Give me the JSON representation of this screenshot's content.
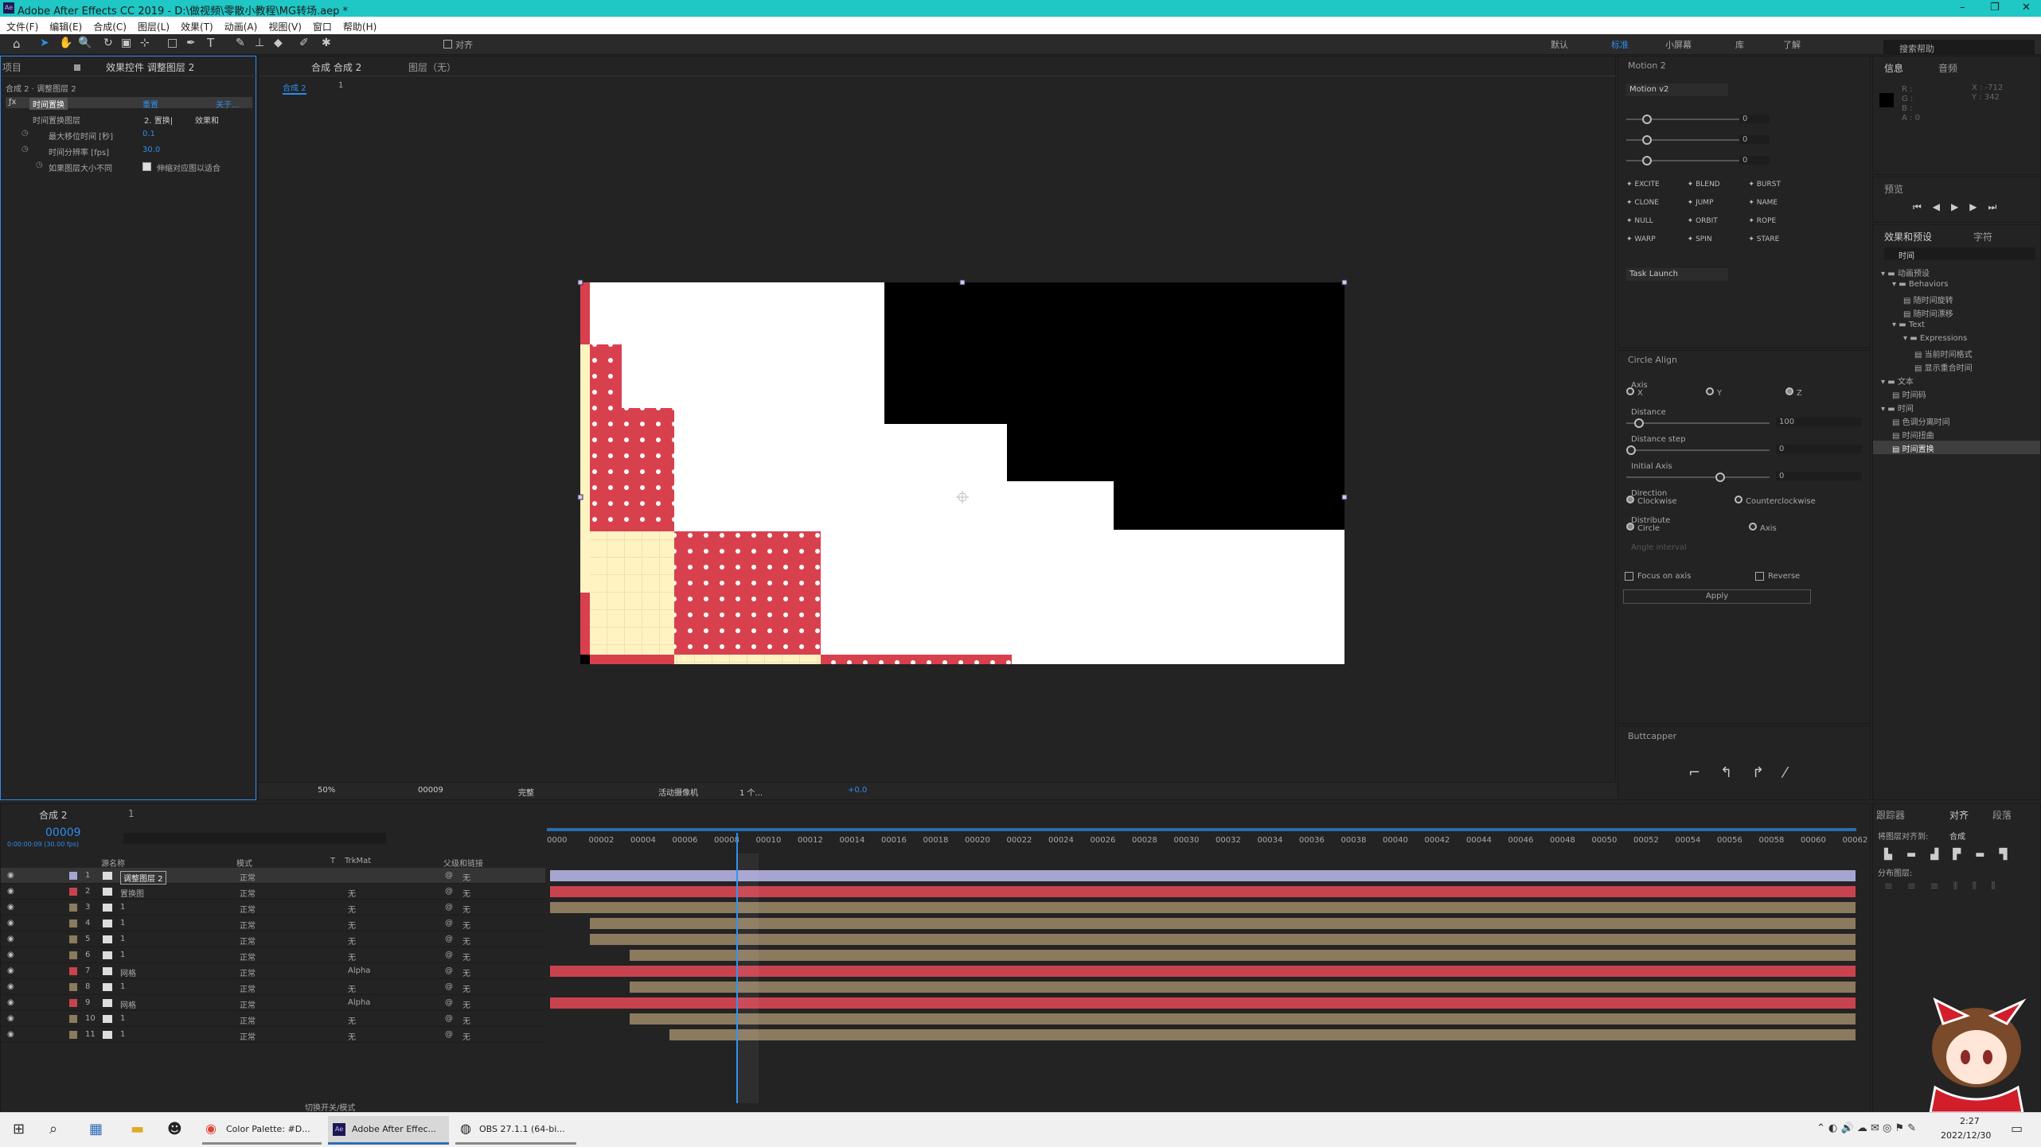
{
  "window": {
    "title": "Adobe After Effects CC 2019 - D:\\做视频\\零散小教程\\MG转场.aep *",
    "min": "–",
    "max": "❐",
    "close": "✕"
  },
  "menu": [
    "文件(F)",
    "编辑(E)",
    "合成(C)",
    "图层(L)",
    "效果(T)",
    "动画(A)",
    "视图(V)",
    "窗口",
    "帮助(H)"
  ],
  "toolbar": {
    "align_label": "对齐",
    "workspaces": [
      "默认",
      "标准",
      "小屏幕",
      "库",
      "了解"
    ],
    "active_workspace": "标准",
    "search_placeholder": "搜索帮助"
  },
  "effect_controls": {
    "project_tab": "项目",
    "tab": "效果控件 调整图层 2",
    "breadcrumb": "合成 2 · 调整图层 2",
    "effect_name": "时间置换",
    "reset": "重置",
    "about": "关于...",
    "rows": [
      {
        "label": "时间置换图层",
        "value": "2. 置换|",
        "value2": "效果和"
      },
      {
        "label": "最大移位时间 [秒]",
        "value": "0.1"
      },
      {
        "label": "时间分辨率 [fps]",
        "value": "30.0"
      },
      {
        "label": "如果图层大小不同",
        "value": "伸缩对应图以适合"
      }
    ]
  },
  "composition": {
    "tab": "合成 合成 2",
    "layer_tab": "图层（无）",
    "crumb": "合成 2",
    "crumb2": "1",
    "zoom": "50%",
    "timecode": "00009",
    "quality": "完整",
    "camera": "活动摄像机",
    "views": "1 个...",
    "exposure": "+0.0"
  },
  "motion": {
    "title": "Motion 2",
    "version": "Motion v2",
    "sliders": [
      "0",
      "0",
      "0"
    ],
    "buttons": [
      "EXCITE",
      "BLEND",
      "BURST",
      "CLONE",
      "JUMP",
      "NAME",
      "NULL",
      "ORBIT",
      "ROPE",
      "WARP",
      "SPIN",
      "STARE"
    ],
    "task": "Task Launch"
  },
  "circle_align": {
    "title": "Circle Align",
    "axis": "Axis",
    "axes": [
      "X",
      "Y",
      "Z"
    ],
    "distance": "Distance",
    "distance_value": "100",
    "distance_step": "Distance step",
    "distance_step_value": "0",
    "initial_axis": "Initial Axis",
    "initial_axis_value": "0",
    "direction": "Direction",
    "cw": "Clockwise",
    "ccw": "Counterclockwise",
    "distribute": "Distribute",
    "circle": "Circle",
    "axis_opt": "Axis",
    "angle": "Angle interval",
    "focus": "Focus on axis",
    "reverse": "Reverse",
    "apply": "Apply"
  },
  "buttcapper": {
    "title": "Buttcapper"
  },
  "info": {
    "tab": "信息",
    "tab2": "音频",
    "r": "R :",
    "g": "G :",
    "b": "B :",
    "a": "A : 0",
    "x": "X : -712",
    "y": "Y : 342"
  },
  "preview": {
    "tab": "预览"
  },
  "effects_presets": {
    "tab": "效果和预设",
    "tab2": "字符",
    "search": "时间",
    "tree": [
      {
        "t": "动画预设",
        "d": 0
      },
      {
        "t": "Behaviors",
        "d": 1
      },
      {
        "t": "随时间旋转",
        "d": 2,
        "f": 1
      },
      {
        "t": "随时间漂移",
        "d": 2,
        "f": 1
      },
      {
        "t": "Text",
        "d": 1
      },
      {
        "t": "Expressions",
        "d": 2
      },
      {
        "t": "当前时间格式",
        "d": 3,
        "f": 1
      },
      {
        "t": "显示重合时间",
        "d": 3,
        "f": 1
      },
      {
        "t": "文本",
        "d": 0
      },
      {
        "t": "时间码",
        "d": 1,
        "f": 1
      },
      {
        "t": "时间",
        "d": 0
      },
      {
        "t": "色调分离时间",
        "d": 1,
        "f": 1
      },
      {
        "t": "时间扭曲",
        "d": 1,
        "f": 1
      },
      {
        "t": "时间置换",
        "d": 1,
        "f": 1,
        "sel": 1
      }
    ]
  },
  "align": {
    "tab1": "跟踪器",
    "tab2": "对齐",
    "tab3": "段落",
    "align_to_label": "将图层对齐到:",
    "align_to": "合成",
    "distribute": "分布图层:"
  },
  "timeline": {
    "tab": "合成 2",
    "tab2": "1",
    "timecode": "00009",
    "fps": "0:00:00:09 (30.00 fps)",
    "search_placeholder": "",
    "headers": {
      "name": "源名称",
      "mode": "模式",
      "t": "T",
      "trkmat": "TrkMat",
      "parent": "父级和链接"
    },
    "ruler": [
      "0000",
      "00002",
      "00004",
      "00006",
      "00008",
      "00010",
      "00012",
      "00014",
      "00016",
      "00018",
      "00020",
      "00022",
      "00024",
      "00026",
      "00028",
      "00030",
      "00032",
      "00034",
      "00036",
      "00038",
      "00040",
      "00042",
      "00044",
      "00046",
      "00048",
      "00050",
      "00052",
      "00054",
      "00056",
      "00058",
      "00060",
      "00062"
    ],
    "footer": "切换开关/模式",
    "layers": [
      {
        "n": "1",
        "name": "调整图层 2",
        "mode": "正常",
        "trk": "",
        "parent": "无",
        "color": "#a6a4d0"
      },
      {
        "n": "2",
        "name": "置换图",
        "mode": "正常",
        "trk": "无",
        "parent": "无",
        "color": "#c9434f"
      },
      {
        "n": "3",
        "name": "1",
        "mode": "正常",
        "trk": "无",
        "parent": "无",
        "color": "#8b7a5e"
      },
      {
        "n": "4",
        "name": "1",
        "mode": "正常",
        "trk": "无",
        "parent": "无",
        "color": "#8b7a5e"
      },
      {
        "n": "5",
        "name": "1",
        "mode": "正常",
        "trk": "无",
        "parent": "无",
        "color": "#8b7a5e"
      },
      {
        "n": "6",
        "name": "1",
        "mode": "正常",
        "trk": "无",
        "parent": "无",
        "color": "#8b7a5e"
      },
      {
        "n": "7",
        "name": "网格",
        "mode": "正常",
        "trk": "Alpha",
        "parent": "无",
        "color": "#c9434f"
      },
      {
        "n": "8",
        "name": "1",
        "mode": "正常",
        "trk": "无",
        "parent": "无",
        "color": "#8b7a5e"
      },
      {
        "n": "9",
        "name": "网格",
        "mode": "正常",
        "trk": "Alpha",
        "parent": "无",
        "color": "#c9434f"
      },
      {
        "n": "10",
        "name": "1",
        "mode": "正常",
        "trk": "无",
        "parent": "无",
        "color": "#8b7a5e"
      },
      {
        "n": "11",
        "name": "1",
        "mode": "正常",
        "trk": "无",
        "parent": "无",
        "color": "#8b7a5e"
      }
    ]
  },
  "taskbar": {
    "apps": [
      "Color Palette: #D...",
      "Adobe After Effec...",
      "OBS 27.1.1 (64-bi..."
    ],
    "time": "2:27",
    "date": "2022/12/30"
  },
  "colors": {
    "accent": "#2d8ceb",
    "red": "#d9404e",
    "cream": "#fff3c2",
    "black": "#000000",
    "white": "#ffffff"
  }
}
